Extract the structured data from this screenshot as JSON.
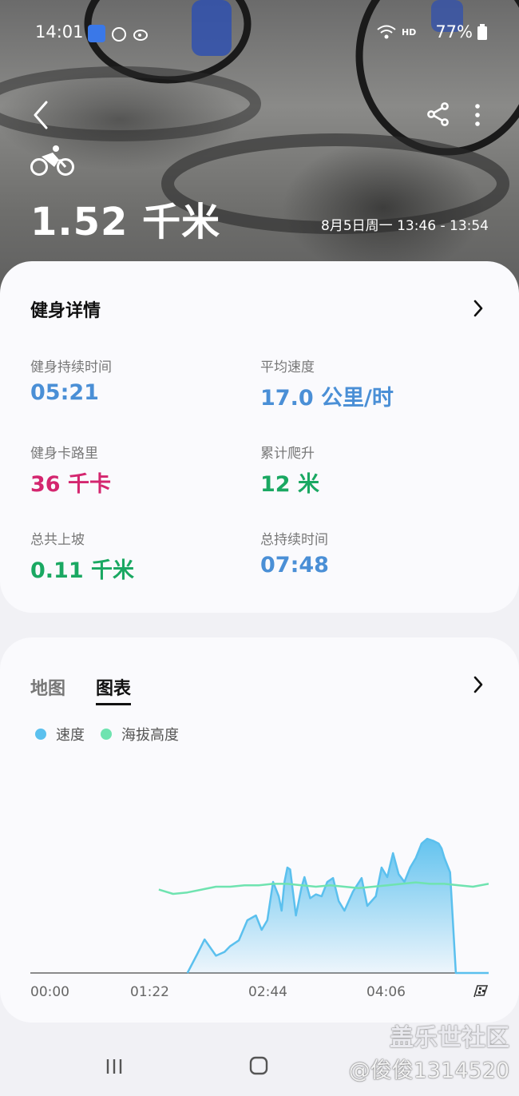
{
  "status_bar": {
    "time": "14:01",
    "network": "HD",
    "battery": "77%"
  },
  "header": {
    "distance": "1.52 千米",
    "time_range": "8月5日周一 13:46 - 13:54"
  },
  "details": {
    "title": "健身详情",
    "stats": [
      {
        "label": "健身持续时间",
        "value": "05:21",
        "color": "#4a8fd6"
      },
      {
        "label": "平均速度",
        "value": "17.0 公里/时",
        "color": "#4a8fd6"
      },
      {
        "label": "健身卡路里",
        "value": "36 千卡",
        "color": "#d4266f"
      },
      {
        "label": "累计爬升",
        "value": "12 米",
        "color": "#1aa862"
      },
      {
        "label": "总共上坡",
        "value": "0.11 千米",
        "color": "#1aa862"
      },
      {
        "label": "总持续时间",
        "value": "07:48",
        "color": "#4a8fd6"
      }
    ]
  },
  "chart_section": {
    "tabs": [
      "地图",
      "图表"
    ],
    "active_tab": "图表",
    "legend": [
      {
        "name": "速度",
        "color": "#5bc0ee"
      },
      {
        "name": "海拔高度",
        "color": "#6fe3b0"
      }
    ]
  },
  "chart_data": {
    "type": "area",
    "x_ticks": [
      "00:00",
      "01:22",
      "02:44",
      "04:06"
    ],
    "x_range_seconds": [
      0,
      321
    ],
    "series": [
      {
        "name": "速度",
        "x_seconds": [
          110,
          117,
          122,
          130,
          136,
          140,
          146,
          152,
          158,
          162,
          166,
          170,
          174,
          176,
          178,
          180,
          182,
          186,
          188,
          190,
          192,
          196,
          200,
          204,
          208,
          212,
          216,
          220,
          226,
          232,
          236,
          242,
          246,
          250,
          254,
          258,
          262,
          266,
          270,
          274,
          278,
          282,
          286,
          288,
          290,
          294,
          298,
          302,
          306,
          310,
          314,
          316,
          318,
          321
        ],
        "values": [
          0,
          20,
          35,
          18,
          22,
          28,
          34,
          55,
          60,
          45,
          55,
          95,
          80,
          65,
          95,
          110,
          108,
          60,
          75,
          90,
          100,
          78,
          82,
          80,
          95,
          99,
          75,
          65,
          85,
          99,
          70,
          80,
          110,
          100,
          125,
          103,
          95,
          110,
          120,
          135,
          140,
          138,
          135,
          130,
          120,
          105,
          0,
          0,
          0,
          0,
          0,
          0,
          0,
          0
        ]
      },
      {
        "name": "海拔高度",
        "x_seconds": [
          90,
          100,
          110,
          120,
          130,
          140,
          150,
          160,
          170,
          180,
          190,
          200,
          210,
          220,
          230,
          240,
          250,
          260,
          270,
          280,
          290,
          300,
          310,
          321
        ],
        "values": [
          58,
          55,
          56,
          58,
          60,
          60,
          61,
          61,
          62,
          62,
          61,
          60,
          61,
          60,
          59,
          60,
          61,
          62,
          63,
          62,
          62,
          61,
          60,
          62
        ]
      }
    ]
  },
  "watermark": {
    "line1": "盖乐世社区",
    "line2": "@俊俊1314520"
  }
}
